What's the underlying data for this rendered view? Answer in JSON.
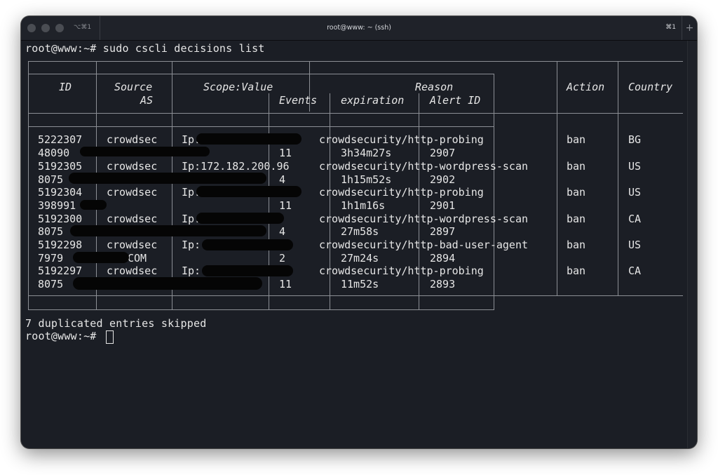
{
  "window": {
    "title": "root@www: ~ (ssh)",
    "shortcut_left": "⌥⌘1",
    "shortcut_right": "⌘1",
    "new_tab": "+"
  },
  "terminal": {
    "prompt_line": "root@www:~# sudo cscli decisions list",
    "footer_line": "7 duplicated entries skipped",
    "prompt": "root@www:~#",
    "headers": {
      "id": "ID",
      "source": "Source",
      "as": "AS",
      "scope_value": "Scope:Value",
      "events": "Events",
      "reason": "Reason",
      "expiration": "expiration",
      "alert_id": "Alert ID",
      "action": "Action",
      "country": "Country"
    },
    "rows": [
      {
        "id": "5222307",
        "source": "crowdsec",
        "scope": "Ip:",
        "reason": "crowdsecurity/http-probing",
        "action": "ban",
        "country": "BG",
        "as": "48090",
        "events": "11",
        "expiration": "3h34m27s",
        "alert_id": "2907"
      },
      {
        "id": "5192305",
        "source": "crowdsec",
        "scope": "Ip:172.182.200.96",
        "reason": "crowdsecurity/http-wordpress-scan",
        "action": "ban",
        "country": "US",
        "as": "8075",
        "events": "4",
        "expiration": "1h15m52s",
        "alert_id": "2902"
      },
      {
        "id": "5192304",
        "source": "crowdsec",
        "scope": "Ip:",
        "reason": "crowdsecurity/http-probing",
        "action": "ban",
        "country": "US",
        "as": "398991",
        "events": "11",
        "expiration": "1h1m16s",
        "alert_id": "2901"
      },
      {
        "id": "5192300",
        "source": "crowdsec",
        "scope": "Ip:",
        "reason": "crowdsecurity/http-wordpress-scan",
        "action": "ban",
        "country": "CA",
        "as": "8075",
        "events": "4",
        "expiration": "27m58s",
        "alert_id": "2897"
      },
      {
        "id": "5192298",
        "source": "crowdsec",
        "scope": "Ip:",
        "reason": "crowdsecurity/http-bad-user-agent",
        "action": "ban",
        "country": "US",
        "as": "7979",
        "as_suffix": "COM",
        "events": "2",
        "expiration": "27m24s",
        "alert_id": "2894"
      },
      {
        "id": "5192297",
        "source": "crowdsec",
        "scope": "Ip:",
        "reason": "crowdsecurity/http-probing",
        "action": "ban",
        "country": "CA",
        "as": "8075",
        "events": "11",
        "expiration": "11m52s",
        "alert_id": "2893"
      }
    ]
  }
}
